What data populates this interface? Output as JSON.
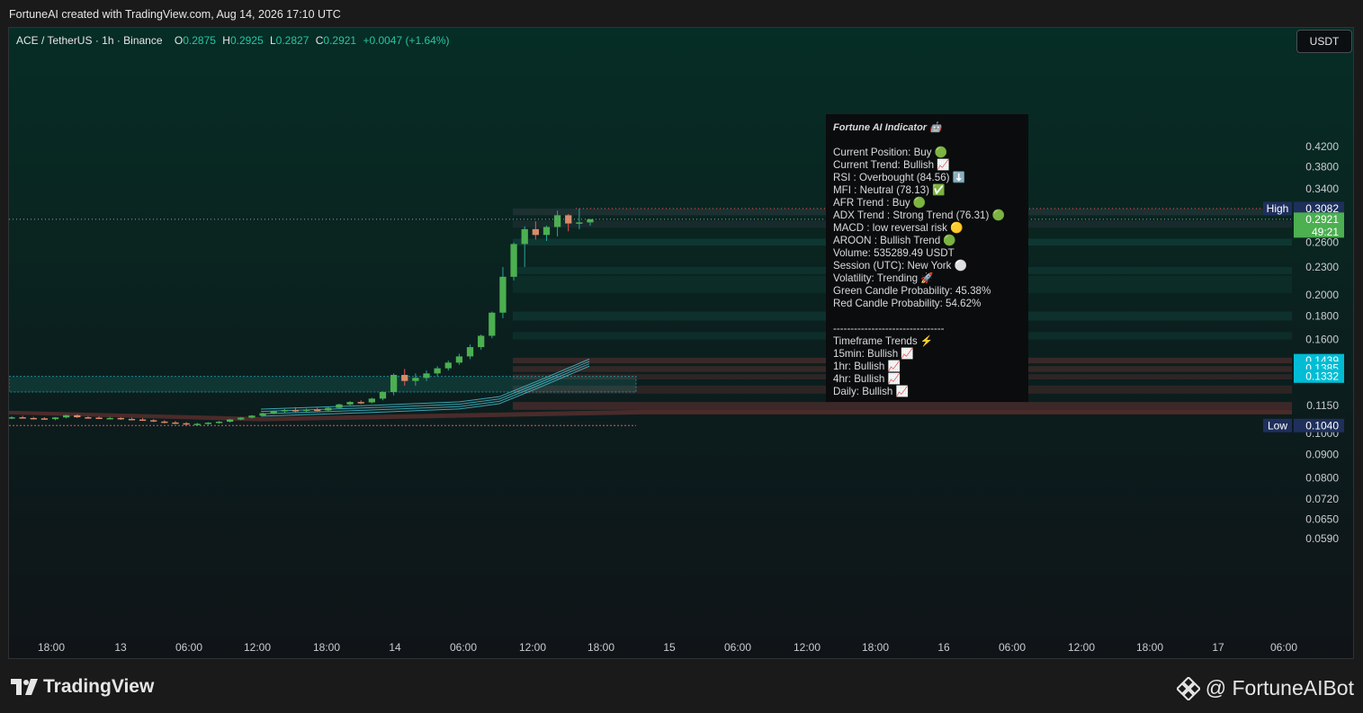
{
  "header": {
    "attribution": "FortuneAI created with TradingView.com, Aug 14, 2026 17:10 UTC"
  },
  "legend": {
    "symbol": "ACE / TetherUS · 1h · Binance",
    "o_label": "O",
    "o": "0.2875",
    "h_label": "H",
    "h": "0.2925",
    "l_label": "L",
    "l": "0.2827",
    "c_label": "C",
    "c": "0.2921",
    "change": "+0.0047 (+1.64%)"
  },
  "currency_button": "USDT",
  "indicator": {
    "title": "Fortune AI Indicator 🤖",
    "lines": [
      "Current Position: Buy 🟢",
      "Current Trend: Bullish 📈",
      "RSI : Overbought (84.56) ⬇️",
      "MFI : Neutral (78.13) ✅",
      "AFR Trend : Buy 🟢",
      "ADX Trend : Strong Trend (76.31) 🟢",
      "MACD : low reversal risk 🟡",
      "AROON : Bullish Trend 🟢",
      "Volume: 535289.49 USDT",
      "Session (UTC): New York ⚪",
      "Volatility: Trending 🚀",
      "Green Candle Probability: 45.38%",
      "Red Candle Probability: 54.62%"
    ],
    "separator": "--------------------------------",
    "tf_title": "Timeframe Trends ⚡",
    "tf_lines": [
      "15min: Bullish 📈",
      "1hr: Bullish 📈",
      "4hr: Bullish 📈",
      "Daily: Bullish 📈"
    ]
  },
  "footer": {
    "brand": "TradingView",
    "handle": "@ FortuneAIBot"
  },
  "chart_data": {
    "type": "candlestick",
    "scale": "log",
    "y_ticks": [
      0.42,
      0.38,
      0.34,
      0.26,
      0.23,
      0.2,
      0.18,
      0.16,
      0.115,
      0.1,
      0.09,
      0.08,
      0.072,
      0.065,
      0.059
    ],
    "x_ticks": [
      "18:00",
      "13",
      "06:00",
      "12:00",
      "18:00",
      "14",
      "06:00",
      "12:00",
      "18:00",
      "15",
      "06:00",
      "12:00",
      "18:00",
      "16",
      "06:00",
      "12:00",
      "18:00",
      "17",
      "06:00"
    ],
    "price_labels": [
      {
        "text": "0.3082",
        "tag": "High",
        "value": 0.3082,
        "color": "#1e2f5c"
      },
      {
        "text": "0.2921",
        "sub": "49:21",
        "value": 0.2921,
        "color": "#4caf50"
      },
      {
        "text": "0.1439",
        "value": 0.1439,
        "color": "#00bcd4"
      },
      {
        "text": "0.1385",
        "value": 0.1385,
        "color": "#00bcd4"
      },
      {
        "text": "0.1332",
        "value": 0.1332,
        "color": "#00bcd4"
      },
      {
        "text": "0.1040",
        "tag": "Low",
        "value": 0.104,
        "color": "#1e2f5c"
      }
    ],
    "current_price": 0.2921,
    "candles": [
      [
        0.1082,
        0.109,
        0.1074,
        0.1084
      ],
      [
        0.1084,
        0.1092,
        0.1078,
        0.108
      ],
      [
        0.108,
        0.1086,
        0.1072,
        0.1078
      ],
      [
        0.1078,
        0.1084,
        0.107,
        0.1074
      ],
      [
        0.1074,
        0.1085,
        0.1068,
        0.1083
      ],
      [
        0.1083,
        0.1098,
        0.1078,
        0.1095
      ],
      [
        0.1095,
        0.11,
        0.108,
        0.1084
      ],
      [
        0.1084,
        0.109,
        0.1076,
        0.1082
      ],
      [
        0.1082,
        0.1088,
        0.1074,
        0.1079
      ],
      [
        0.1079,
        0.1086,
        0.1072,
        0.108
      ],
      [
        0.108,
        0.1084,
        0.107,
        0.1075
      ],
      [
        0.1075,
        0.1082,
        0.1068,
        0.1072
      ],
      [
        0.1072,
        0.108,
        0.1064,
        0.1068
      ],
      [
        0.1068,
        0.1074,
        0.1058,
        0.1061
      ],
      [
        0.1061,
        0.1068,
        0.1052,
        0.1056
      ],
      [
        0.1056,
        0.1064,
        0.1048,
        0.1052
      ],
      [
        0.1052,
        0.1058,
        0.1042,
        0.1046
      ],
      [
        0.1046,
        0.1054,
        0.104,
        0.1049
      ],
      [
        0.1049,
        0.1058,
        0.1044,
        0.1055
      ],
      [
        0.1055,
        0.1064,
        0.105,
        0.106
      ],
      [
        0.106,
        0.1075,
        0.1056,
        0.1072
      ],
      [
        0.1072,
        0.1085,
        0.1068,
        0.1082
      ],
      [
        0.1082,
        0.1096,
        0.1078,
        0.1093
      ],
      [
        0.1093,
        0.111,
        0.1088,
        0.1106
      ],
      [
        0.1106,
        0.1122,
        0.11,
        0.1118
      ],
      [
        0.1118,
        0.113,
        0.1108,
        0.1124
      ],
      [
        0.1124,
        0.114,
        0.1112,
        0.112
      ],
      [
        0.112,
        0.1132,
        0.111,
        0.1126
      ],
      [
        0.1126,
        0.1138,
        0.1116,
        0.1122
      ],
      [
        0.1122,
        0.114,
        0.1118,
        0.1136
      ],
      [
        0.1136,
        0.116,
        0.113,
        0.1156
      ],
      [
        0.1156,
        0.1175,
        0.115,
        0.117
      ],
      [
        0.117,
        0.118,
        0.1158,
        0.1168
      ],
      [
        0.1168,
        0.1195,
        0.1162,
        0.119
      ],
      [
        0.119,
        0.1235,
        0.118,
        0.123
      ],
      [
        0.123,
        0.135,
        0.121,
        0.134
      ],
      [
        0.134,
        0.138,
        0.127,
        0.13
      ],
      [
        0.13,
        0.135,
        0.127,
        0.132
      ],
      [
        0.132,
        0.137,
        0.13,
        0.135
      ],
      [
        0.135,
        0.14,
        0.133,
        0.1385
      ],
      [
        0.1385,
        0.144,
        0.137,
        0.1425
      ],
      [
        0.1425,
        0.149,
        0.141,
        0.147
      ],
      [
        0.147,
        0.156,
        0.145,
        0.154
      ],
      [
        0.154,
        0.164,
        0.152,
        0.163
      ],
      [
        0.163,
        0.184,
        0.161,
        0.183
      ],
      [
        0.183,
        0.23,
        0.178,
        0.219
      ],
      [
        0.219,
        0.26,
        0.215,
        0.258
      ],
      [
        0.258,
        0.282,
        0.23,
        0.278
      ],
      [
        0.278,
        0.289,
        0.264,
        0.27
      ],
      [
        0.27,
        0.283,
        0.262,
        0.281
      ],
      [
        0.281,
        0.305,
        0.268,
        0.298
      ],
      [
        0.298,
        0.3,
        0.275,
        0.286
      ],
      [
        0.286,
        0.3082,
        0.278,
        0.2875
      ],
      [
        0.2875,
        0.2925,
        0.2827,
        0.2921
      ]
    ]
  }
}
